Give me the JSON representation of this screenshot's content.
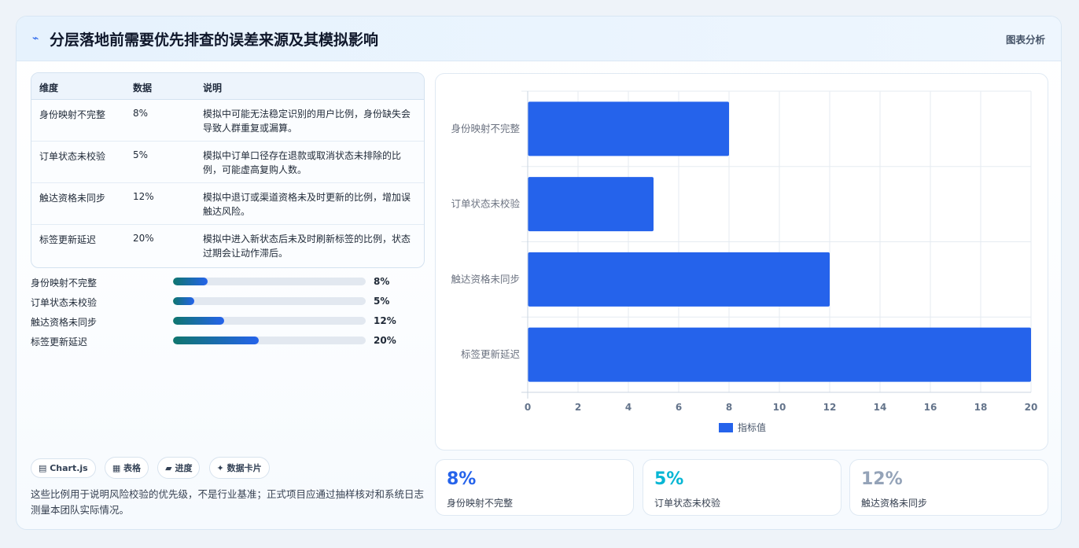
{
  "header": {
    "title": "分层落地前需要优先排查的误差来源及其模拟影响",
    "tag": "图表分析"
  },
  "table": {
    "headers": [
      "维度",
      "数据",
      "说明"
    ],
    "rows": [
      {
        "dim": "身份映射不完整",
        "val": "8%",
        "desc": "模拟中可能无法稳定识别的用户比例，身份缺失会导致人群重复或漏算。"
      },
      {
        "dim": "订单状态未校验",
        "val": "5%",
        "desc": "模拟中订单口径存在退款或取消状态未排除的比例，可能虚高复购人数。"
      },
      {
        "dim": "触达资格未同步",
        "val": "12%",
        "desc": "模拟中退订或渠道资格未及时更新的比例，增加误触达风险。"
      },
      {
        "dim": "标签更新延迟",
        "val": "20%",
        "desc": "模拟中进入新状态后未及时刷新标签的比例，状态过期会让动作滞后。"
      }
    ]
  },
  "progress": [
    {
      "label": "身份映射不完整",
      "value": 8,
      "text": "8%"
    },
    {
      "label": "订单状态未校验",
      "value": 5,
      "text": "5%"
    },
    {
      "label": "触达资格未同步",
      "value": 12,
      "text": "12%"
    },
    {
      "label": "标签更新延迟",
      "value": 20,
      "text": "20%"
    }
  ],
  "progress_max": 45,
  "chips": [
    "▤ Chart.js",
    "▦ 表格",
    "▰ 进度",
    "✦ 数据卡片"
  ],
  "note": "这些比例用于说明风险校验的优先级，不是行业基准；正式项目应通过抽样核对和系统日志测量本团队实际情况。",
  "stats": [
    {
      "num": "8%",
      "label": "身份映射不完整",
      "color": "#2563eb"
    },
    {
      "num": "5%",
      "label": "订单状态未校验",
      "color": "#06b6d4"
    },
    {
      "num": "12%",
      "label": "触达资格未同步",
      "color": "#94a3b8"
    }
  ],
  "chart_data": {
    "type": "bar",
    "orientation": "horizontal",
    "categories": [
      "身份映射不完整",
      "订单状态未校验",
      "触达资格未同步",
      "标签更新延迟"
    ],
    "series": [
      {
        "name": "指标值",
        "values": [
          8,
          5,
          12,
          20
        ],
        "color": "#2563eb"
      }
    ],
    "xlim": [
      0,
      20
    ],
    "xticks": [
      0,
      2,
      4,
      6,
      8,
      10,
      12,
      14,
      16,
      18,
      20
    ],
    "grid": true,
    "legend": "bottom"
  }
}
